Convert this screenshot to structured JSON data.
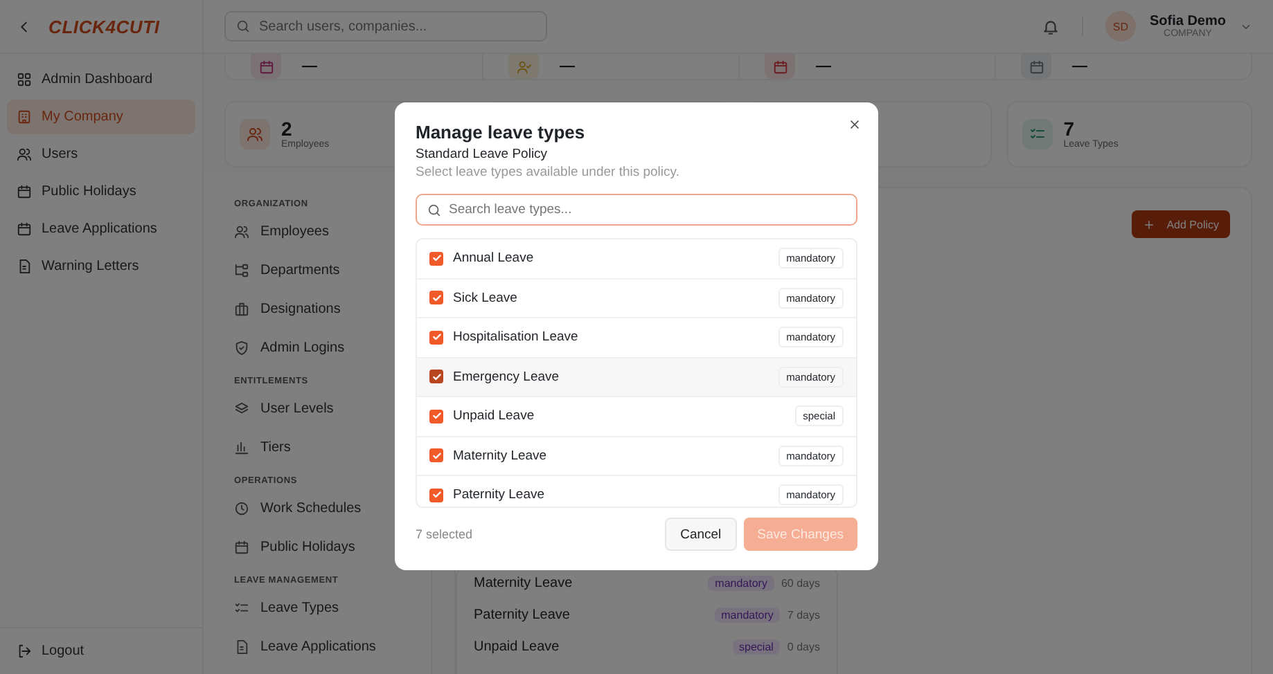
{
  "sidebar": {
    "logo": "CLICK4CUTI",
    "items": [
      {
        "label": "Admin Dashboard",
        "selected": false
      },
      {
        "label": "My Company",
        "selected": true
      },
      {
        "label": "Users",
        "selected": false
      },
      {
        "label": "Public Holidays",
        "selected": false
      },
      {
        "label": "Leave Applications",
        "selected": false
      },
      {
        "label": "Warning Letters",
        "selected": false
      }
    ],
    "logout": "Logout"
  },
  "header": {
    "search_placeholder": "Search users, companies...",
    "user": {
      "initials": "SD",
      "name": "Sofia Demo",
      "role": "COMPANY"
    }
  },
  "summary": [
    {
      "value": "—"
    },
    {
      "value": "—"
    },
    {
      "value": "—"
    },
    {
      "value": "—"
    }
  ],
  "stats": [
    {
      "value": "2",
      "label": "Employees"
    },
    {
      "value": "7",
      "label": "Leave Types"
    }
  ],
  "secondary_nav": [
    {
      "title": "ORGANIZATION",
      "items": [
        "Employees",
        "Departments",
        "Designations",
        "Admin Logins"
      ]
    },
    {
      "title": "ENTITLEMENTS",
      "items": [
        "User Levels",
        "Tiers"
      ]
    },
    {
      "title": "OPERATIONS",
      "items": [
        "Work Schedules",
        "Public Holidays"
      ]
    },
    {
      "title": "LEAVE MANAGEMENT",
      "items": [
        "Leave Types",
        "Leave Applications"
      ]
    }
  ],
  "policies": {
    "add_button": "Add Policy",
    "rows": [
      {
        "name": "Maternity Leave",
        "tag": "mandatory",
        "days": "60 days"
      },
      {
        "name": "Paternity Leave",
        "tag": "mandatory",
        "days": "7 days"
      },
      {
        "name": "Unpaid Leave",
        "tag": "special",
        "days": "0 days"
      }
    ]
  },
  "modal": {
    "title": "Manage leave types",
    "subtitle": "Standard Leave Policy",
    "description": "Select leave types available under this policy.",
    "search_placeholder": "Search leave types...",
    "items": [
      {
        "name": "Annual Leave",
        "checked": true,
        "highlighted": false,
        "tag": "mandatory"
      },
      {
        "name": "Sick Leave",
        "checked": true,
        "highlighted": false,
        "tag": "mandatory"
      },
      {
        "name": "Hospitalisation Leave",
        "checked": true,
        "highlighted": false,
        "tag": "mandatory"
      },
      {
        "name": "Emergency Leave",
        "checked": true,
        "highlighted": true,
        "tag": "mandatory"
      },
      {
        "name": "Unpaid Leave",
        "checked": true,
        "highlighted": false,
        "tag": "special"
      },
      {
        "name": "Maternity Leave",
        "checked": true,
        "highlighted": false,
        "tag": "mandatory"
      },
      {
        "name": "Paternity Leave",
        "checked": true,
        "highlighted": false,
        "tag": "mandatory"
      }
    ],
    "count": "7 selected",
    "cancel": "Cancel",
    "save": {
      "label": "Save Changes",
      "disabled": true
    }
  }
}
